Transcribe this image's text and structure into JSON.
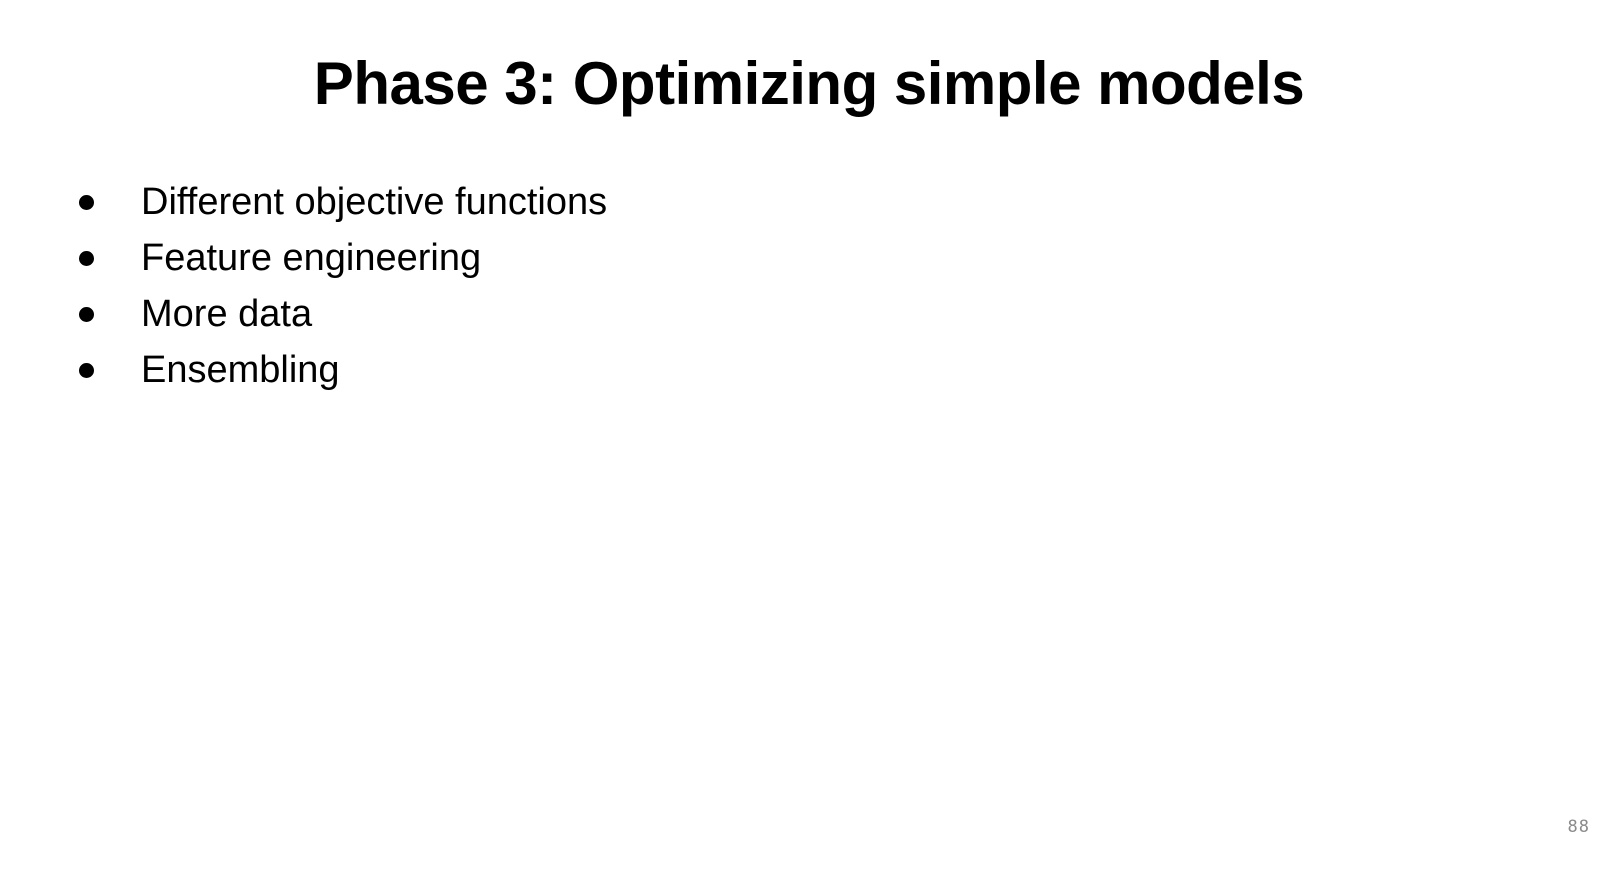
{
  "slide": {
    "title": "Phase 3: Optimizing simple models",
    "bullets": [
      "Different objective functions",
      "Feature engineering",
      "More data",
      "Ensembling"
    ],
    "page_number": "88"
  }
}
